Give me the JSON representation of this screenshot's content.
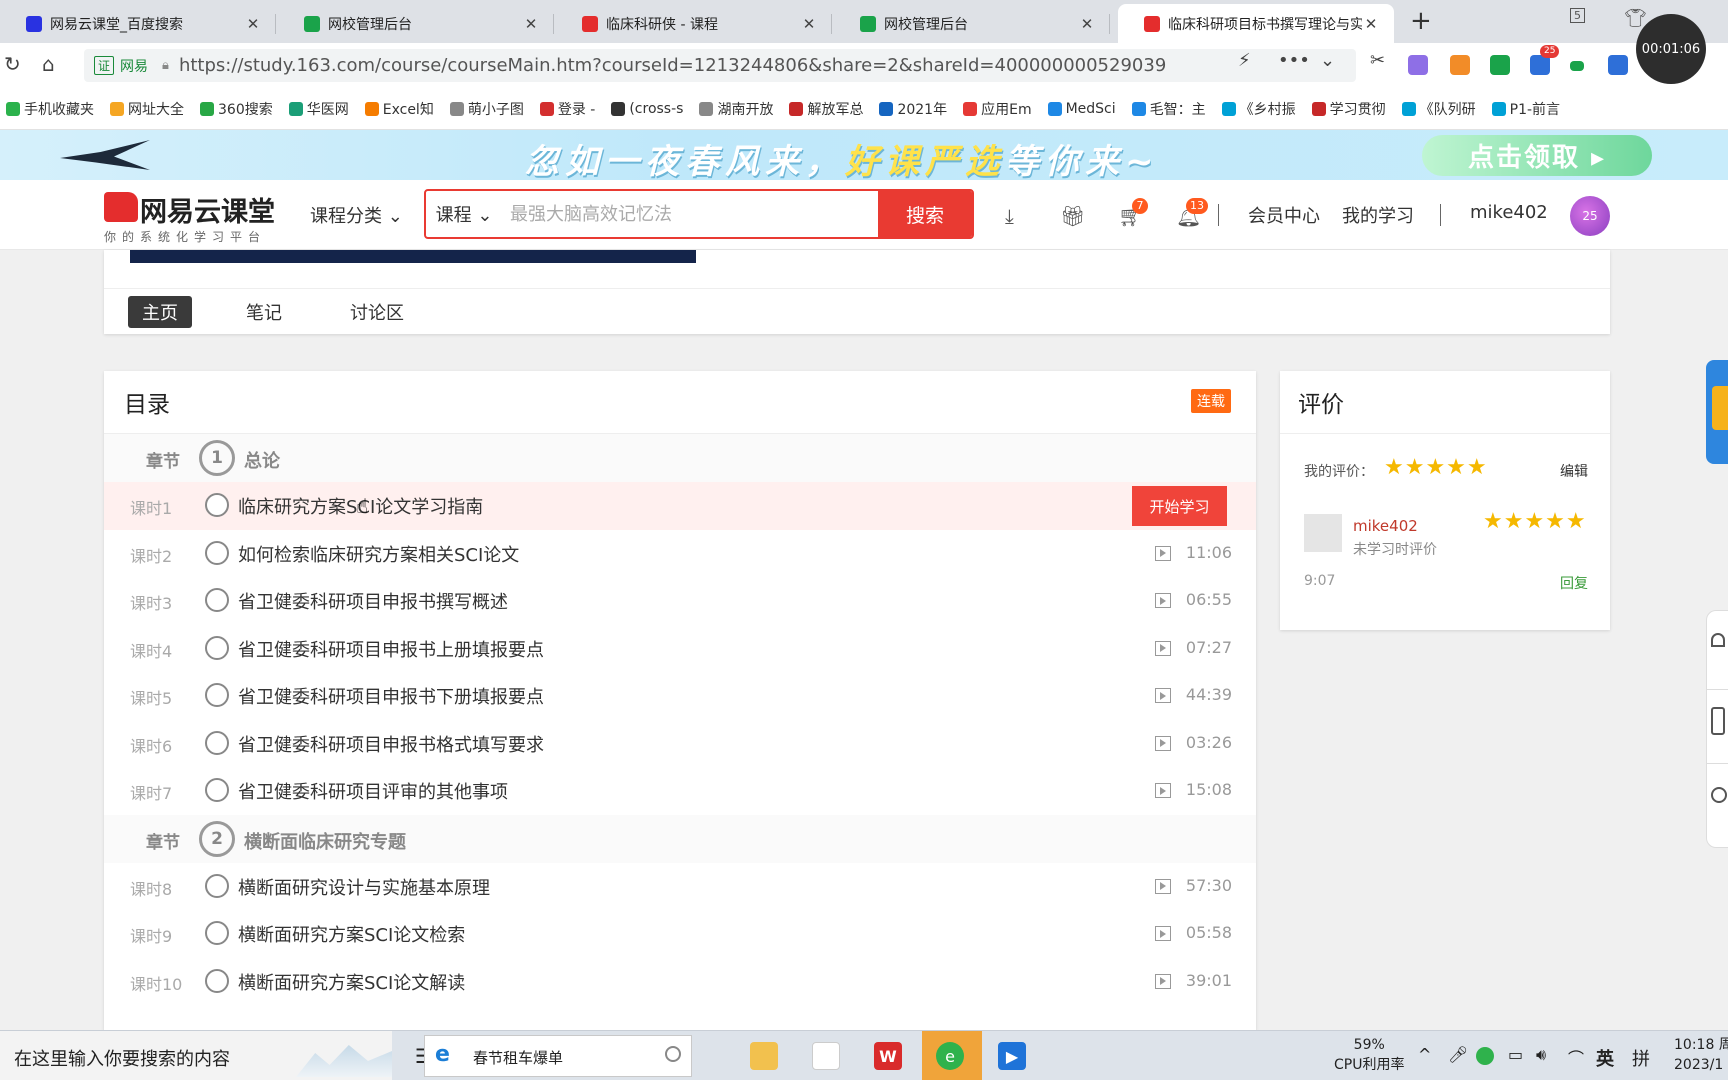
{
  "browser": {
    "tabs": [
      {
        "title": "网易云课堂_百度搜索",
        "fav_color": "#2932e1",
        "active": false
      },
      {
        "title": "网校管理后台",
        "fav_color": "#1aa34a",
        "active": false
      },
      {
        "title": "临床科研侠 - 课程",
        "fav_color": "#e42d2d",
        "active": false
      },
      {
        "title": "网校管理后台",
        "fav_color": "#1aa34a",
        "active": false
      },
      {
        "title": "临床科研项目标书撰写理论与实",
        "fav_color": "#e42d2d",
        "active": true
      }
    ],
    "tab_count_badge": "5",
    "cert_badge": "证",
    "cert_label": "网易",
    "url": "https://study.163.com/course/courseMain.htm?courseId=1213244806&share=2&shareId=400000000529039",
    "recording_timer": "00:01:06",
    "ext_badge": "25"
  },
  "bookmarks": [
    {
      "label": "手机收藏夹",
      "color": "#2bb24c"
    },
    {
      "label": "网址大全",
      "color": "#f5a623"
    },
    {
      "label": "360搜索",
      "color": "#28a745"
    },
    {
      "label": "华医网",
      "color": "#1b9e77"
    },
    {
      "label": "Excel知",
      "color": "#f57c00"
    },
    {
      "label": "萌小子图",
      "color": "#888888"
    },
    {
      "label": "登录 -",
      "color": "#d32f2f"
    },
    {
      "label": "(cross-s",
      "color": "#333333"
    },
    {
      "label": "湖南开放",
      "color": "#888888"
    },
    {
      "label": "解放军总",
      "color": "#c62828"
    },
    {
      "label": "2021年",
      "color": "#1565c0"
    },
    {
      "label": "应用Em",
      "color": "#e53935"
    },
    {
      "label": "MedSci",
      "color": "#1e88e5"
    },
    {
      "label": "毛智：主",
      "color": "#1e88e5"
    },
    {
      "label": "《乡村振",
      "color": "#00a1d6"
    },
    {
      "label": "学习贯彻",
      "color": "#c62828"
    },
    {
      "label": "《队列研",
      "color": "#00a1d6"
    },
    {
      "label": "P1-前言",
      "color": "#00a1d6"
    }
  ],
  "banner": {
    "slogan_a": "忽如一夜春风来，",
    "slogan_b": "好课严选",
    "slogan_c": "等你来~",
    "cta": "点击领取 ▸"
  },
  "header": {
    "logo_name": "网易云课堂",
    "logo_tagline": "你的系统化学习平台",
    "category_menu": "课程分类 ⌄",
    "search_type": "课程 ⌄",
    "search_placeholder": "最强大脑高效记忆法",
    "search_button": "搜索",
    "cart_badge": "7",
    "bell_badge": "13",
    "member_center": "会员中心",
    "my_learning": "我的学习",
    "username": "mike402",
    "avatar_text": "25"
  },
  "course_tabs": [
    {
      "label": "主页",
      "active": true
    },
    {
      "label": "笔记",
      "active": false
    },
    {
      "label": "讨论区",
      "active": false
    }
  ],
  "catalog": {
    "title": "目录",
    "status_badge": "连载",
    "start_button": "开始学习",
    "chapter_label": "章节",
    "sections": [
      {
        "number": "1",
        "title": "总论",
        "lessons": [
          {
            "label": "课时1",
            "title": "临床研究方案SCI论文学习指南",
            "duration": "",
            "active": true
          },
          {
            "label": "课时2",
            "title": "如何检索临床研究方案相关SCI论文",
            "duration": "11:06",
            "active": false
          },
          {
            "label": "课时3",
            "title": "省卫健委科研项目申报书撰写概述",
            "duration": "06:55",
            "active": false
          },
          {
            "label": "课时4",
            "title": "省卫健委科研项目申报书上册填报要点",
            "duration": "07:27",
            "active": false
          },
          {
            "label": "课时5",
            "title": "省卫健委科研项目申报书下册填报要点",
            "duration": "44:39",
            "active": false
          },
          {
            "label": "课时6",
            "title": "省卫健委科研项目申报书格式填写要求",
            "duration": "03:26",
            "active": false
          },
          {
            "label": "课时7",
            "title": "省卫健委科研项目评审的其他事项",
            "duration": "15:08",
            "active": false
          }
        ]
      },
      {
        "number": "2",
        "title": "横断面临床研究专题",
        "lessons": [
          {
            "label": "课时8",
            "title": "横断面研究设计与实施基本原理",
            "duration": "57:30",
            "active": false
          },
          {
            "label": "课时9",
            "title": "横断面研究方案SCI论文检索",
            "duration": "05:58",
            "active": false
          },
          {
            "label": "课时10",
            "title": "横断面研究方案SCI论文解读",
            "duration": "39:01",
            "active": false
          }
        ]
      }
    ]
  },
  "review": {
    "title": "评价",
    "my_rating_label": "我的评价：",
    "my_stars": "★★★★★",
    "edit": "编辑",
    "user": "mike402",
    "user_stars": "★★★★★",
    "note": "未学习时评价",
    "time": "9:07",
    "reply": "回复"
  },
  "taskbar": {
    "search_placeholder": "在这里输入你要搜索的内容",
    "task_title": "春节租车爆单",
    "cpu_value": "59%",
    "cpu_label": "CPU利用率",
    "ime": "英",
    "ime2": "拼",
    "time": "10:18 周",
    "date": "2023/1"
  }
}
